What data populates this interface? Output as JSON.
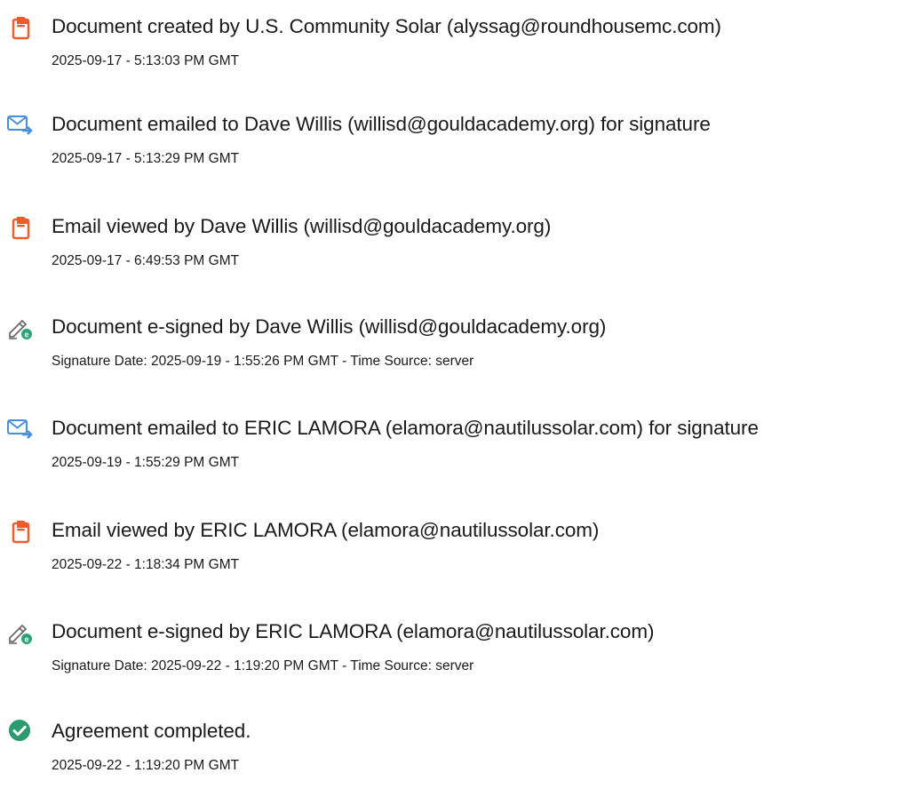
{
  "colors": {
    "doc_icon": "#ef5a2b",
    "email_icon": "#4a90d9",
    "sign_icon": "#6b6b6b",
    "sign_badge": "#2ba37a",
    "complete_icon": "#2b9a6c"
  },
  "events": [
    {
      "icon": "document-icon",
      "title": "Document created by U.S. Community Solar (alyssag@roundhousemc.com)",
      "time": "2025-09-17 - 5:13:03 PM GMT"
    },
    {
      "icon": "email-sent-icon",
      "title": "Document emailed to Dave Willis (willisd@gouldacademy.org) for signature",
      "time": "2025-09-17 - 5:13:29 PM GMT"
    },
    {
      "icon": "document-icon",
      "title": "Email viewed by Dave Willis (willisd@gouldacademy.org)",
      "time": "2025-09-17 - 6:49:53 PM GMT"
    },
    {
      "icon": "e-sign-icon",
      "title": "Document e-signed by Dave Willis (willisd@gouldacademy.org)",
      "time": "Signature Date: 2025-09-19 - 1:55:26 PM GMT - Time Source: server"
    },
    {
      "icon": "email-sent-icon",
      "title": "Document emailed to ERIC LAMORA (elamora@nautilussolar.com) for signature",
      "time": "2025-09-19 - 1:55:29 PM GMT"
    },
    {
      "icon": "document-icon",
      "title": "Email viewed by ERIC LAMORA (elamora@nautilussolar.com)",
      "time": "2025-09-22 - 1:18:34 PM GMT"
    },
    {
      "icon": "e-sign-icon",
      "title": "Document e-signed by ERIC LAMORA (elamora@nautilussolar.com)",
      "time": "Signature Date: 2025-09-22 - 1:19:20 PM GMT - Time Source: server"
    },
    {
      "icon": "checkmark-circle-icon",
      "title": "Agreement completed.",
      "time": "2025-09-22 - 1:19:20 PM GMT"
    }
  ]
}
